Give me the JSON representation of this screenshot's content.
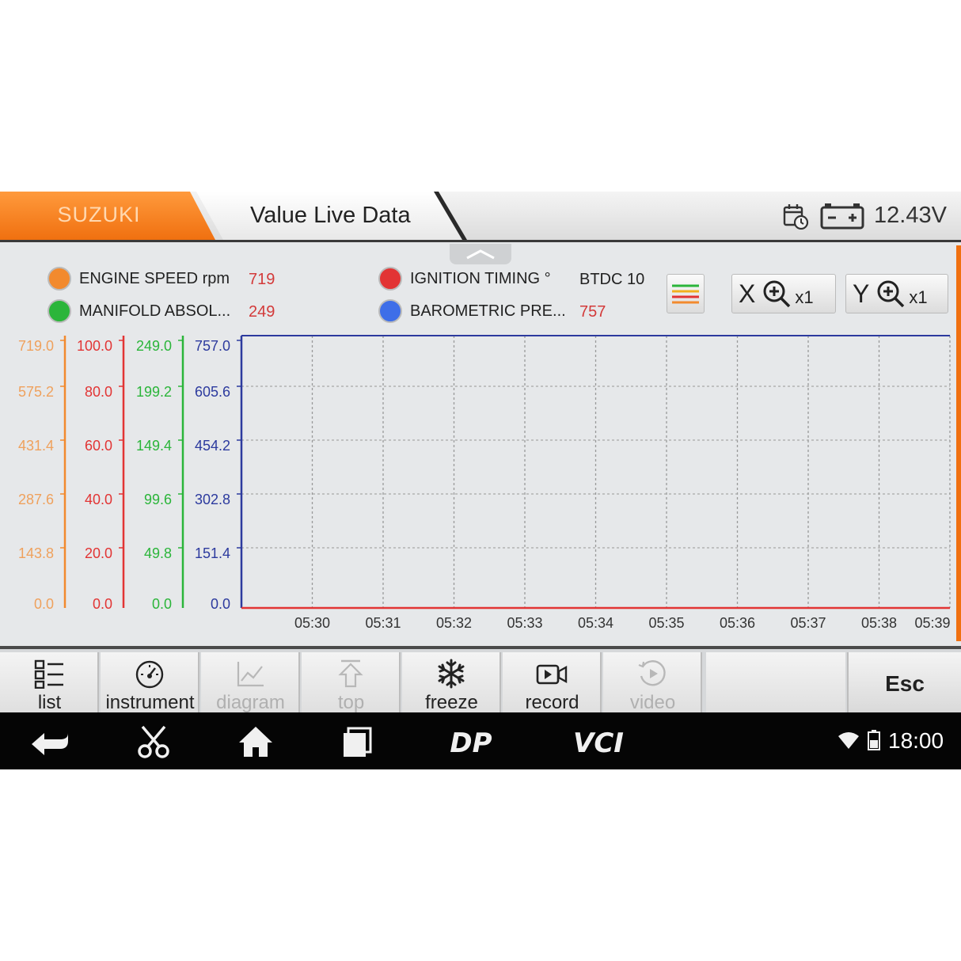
{
  "header": {
    "brand": "SUZUKI",
    "title": "Value Live Data",
    "voltage": "12.43V"
  },
  "legend": [
    {
      "name": "ENGINE SPEED  rpm",
      "value": "719",
      "color": "#f28a2e"
    },
    {
      "name": "MANIFOLD ABSOL...",
      "value": "249",
      "color": "#2bb53a"
    },
    {
      "name": "IGNITION TIMING  °",
      "value": "BTDC 10",
      "color": "#e23434"
    },
    {
      "name": "BAROMETRIC PRE...",
      "value": "757",
      "color": "#3e6ee8"
    }
  ],
  "zoom": {
    "x_axis": "X",
    "x_mult": "x1",
    "y_axis": "Y",
    "y_mult": "x1"
  },
  "chart_data": {
    "type": "line",
    "y_axes": [
      {
        "color": "#f28a2e",
        "ticks": [
          "719.0",
          "575.2",
          "431.4",
          "287.6",
          "143.8",
          "0.0"
        ],
        "ylim": [
          0,
          719
        ]
      },
      {
        "color": "#e23434",
        "ticks": [
          "100.0",
          "80.0",
          "60.0",
          "40.0",
          "20.0",
          "0.0"
        ],
        "ylim": [
          0,
          100
        ]
      },
      {
        "color": "#2bb53a",
        "ticks": [
          "249.0",
          "199.2",
          "149.4",
          "99.6",
          "49.8",
          "0.0"
        ],
        "ylim": [
          0,
          249
        ]
      },
      {
        "color": "#2c3a9e",
        "ticks": [
          "757.0",
          "605.6",
          "454.2",
          "302.8",
          "151.4",
          "0.0"
        ],
        "ylim": [
          0,
          757
        ]
      }
    ],
    "x_ticks": [
      "05:30",
      "05:31",
      "05:32",
      "05:33",
      "05:34",
      "05:35",
      "05:36",
      "05:37",
      "05:38",
      "05:39"
    ],
    "grid": true
  },
  "toolbar": {
    "list": "list",
    "instrument": "instrument",
    "diagram": "diagram",
    "top": "top",
    "freeze": "freeze",
    "record": "record",
    "video": "video",
    "esc": "Esc"
  },
  "navbar": {
    "dp_label": "DP",
    "vci_label": "VCI",
    "clock": "18:00"
  },
  "icons": {
    "calendar": "calendar-clock-icon",
    "battery": "battery-icon",
    "back": "back-arrow-icon",
    "scissors": "scissors-icon",
    "home": "home-icon",
    "recents": "recents-icon",
    "wifi": "wifi-icon",
    "battery_status": "battery-status-icon"
  }
}
